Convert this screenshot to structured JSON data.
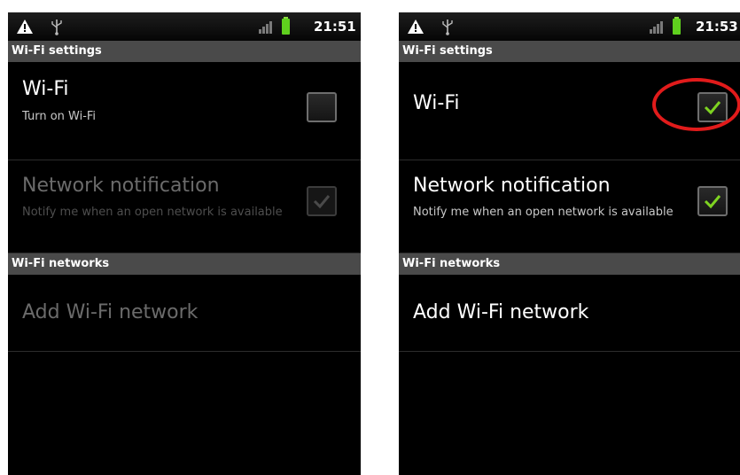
{
  "left": {
    "clock": "21:51",
    "header_settings": "Wi-Fi settings",
    "wifi": {
      "title": "Wi-Fi",
      "subtitle": "Turn on Wi-Fi",
      "checked": false
    },
    "network_notification": {
      "title": "Network notification",
      "subtitle": "Notify me when an open network is available",
      "checked": true,
      "enabled": false
    },
    "header_networks": "Wi-Fi networks",
    "add_network": {
      "title": "Add Wi-Fi network",
      "enabled": false
    }
  },
  "right": {
    "clock": "21:53",
    "header_settings": "Wi-Fi settings",
    "wifi": {
      "title": "Wi-Fi",
      "checked": true
    },
    "network_notification": {
      "title": "Network notification",
      "subtitle": "Notify me when an open network is available",
      "checked": true,
      "enabled": true
    },
    "header_networks": "Wi-Fi networks",
    "add_network": {
      "title": "Add Wi-Fi network",
      "enabled": true
    }
  },
  "icons": [
    "warning-icon",
    "usb-icon",
    "signal-icon",
    "battery-icon",
    "check-icon"
  ],
  "colors": {
    "check_green": "#7ed321",
    "battery_green": "#5fcf1e",
    "highlight_red": "#e11b1b"
  }
}
